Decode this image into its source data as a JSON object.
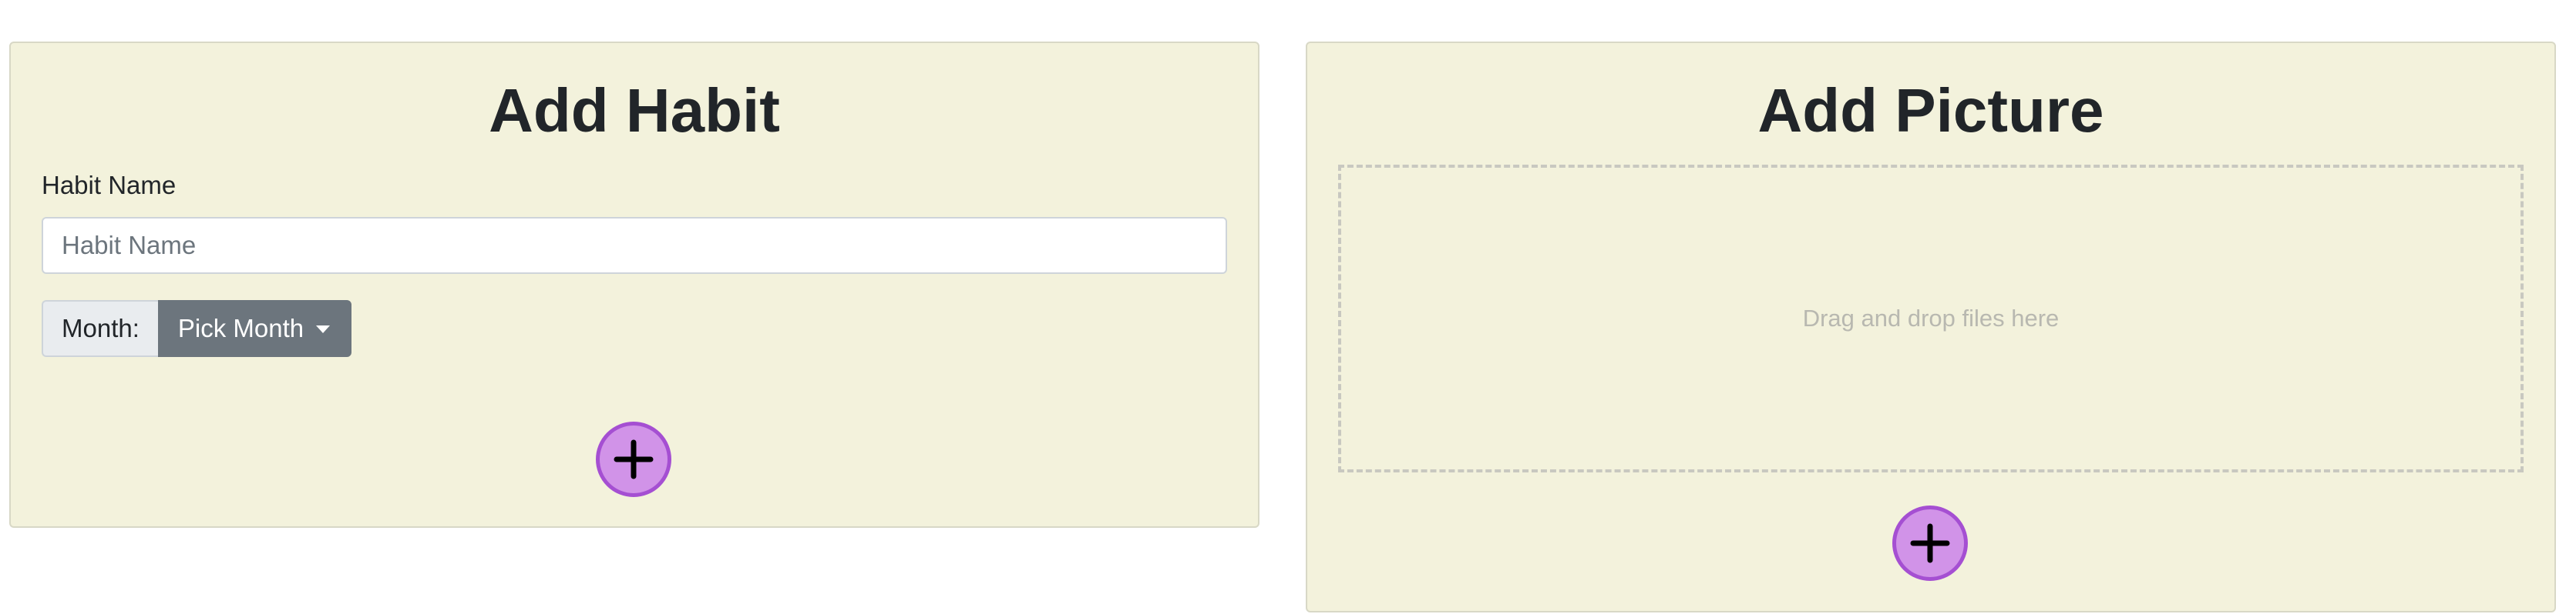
{
  "habit_form": {
    "title": "Add Habit",
    "name_label": "Habit Name",
    "name_placeholder": "Habit Name",
    "name_value": "",
    "month_label": "Month:",
    "month_button": "Pick Month",
    "add_icon": "plus-circle-icon"
  },
  "picture_form": {
    "title": "Add Picture",
    "dropzone_text": "Drag and drop files here",
    "add_icon": "plus-circle-icon"
  },
  "colors": {
    "card_background": "#f3f2dc",
    "add_button_fill": "#d193e8",
    "add_button_border": "#a54fd2",
    "month_button": "#6c757d"
  }
}
